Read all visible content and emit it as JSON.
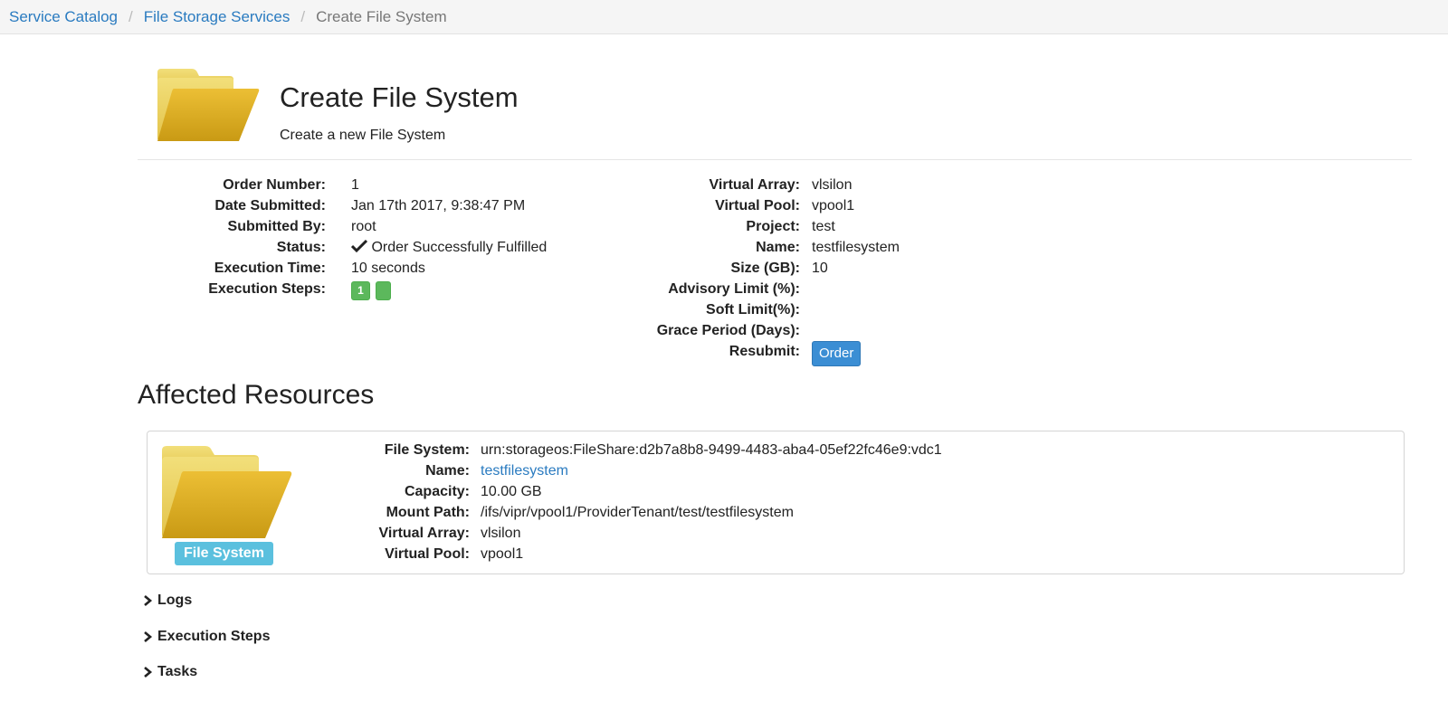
{
  "breadcrumb": {
    "items": [
      "Service Catalog",
      "File Storage Services"
    ],
    "current": "Create File System"
  },
  "header": {
    "title": "Create File System",
    "subtitle": "Create a new File System",
    "icon": "folder-icon"
  },
  "order_details": {
    "order_number_label": "Order Number:",
    "order_number": "1",
    "date_label": "Date Submitted:",
    "date": "Jan 17th 2017, 9:38:47 PM",
    "submitted_by_label": "Submitted By:",
    "submitted_by": "root",
    "status_label": "Status:",
    "status": "Order Successfully Fulfilled",
    "exec_time_label": "Execution Time:",
    "exec_time": "10 seconds",
    "exec_steps_label": "Execution Steps:",
    "exec_steps_badge": "1"
  },
  "params": {
    "virtual_array_label": "Virtual Array:",
    "virtual_array": "vlsilon",
    "virtual_pool_label": "Virtual Pool:",
    "virtual_pool": "vpool1",
    "project_label": "Project:",
    "project": "test",
    "name_label": "Name:",
    "name": "testfilesystem",
    "size_label": "Size (GB):",
    "size": "10",
    "advisory_label": "Advisory Limit (%):",
    "soft_label": "Soft Limit(%):",
    "grace_label": "Grace Period (Days):",
    "resubmit_label": "Resubmit:",
    "order_button": "Order"
  },
  "affected": {
    "heading": "Affected Resources",
    "badge": "File System",
    "fs_label": "File System:",
    "fs": "urn:storageos:FileShare:d2b7a8b8-9499-4483-aba4-05ef22fc46e9:vdc1",
    "name_label": "Name:",
    "name": "testfilesystem",
    "capacity_label": "Capacity:",
    "capacity": "10.00 GB",
    "mount_label": "Mount Path:",
    "mount": "/ifs/vipr/vpool1/ProviderTenant/test/testfilesystem",
    "varray_label": "Virtual Array:",
    "varray": "vlsilon",
    "vpool_label": "Virtual Pool:",
    "vpool": "vpool1"
  },
  "sections": {
    "logs": "Logs",
    "execution_steps": "Execution Steps",
    "tasks": "Tasks"
  },
  "colors": {
    "link": "#2a7bc0",
    "success": "#5cb85c",
    "primary": "#3b8ed4",
    "info": "#5bc0de"
  }
}
